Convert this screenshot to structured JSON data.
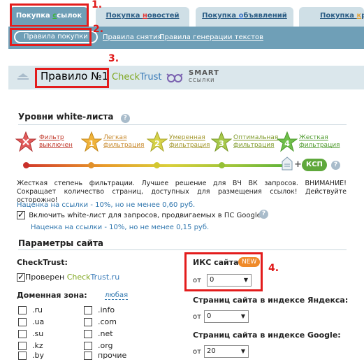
{
  "tabs": [
    {
      "pre": "Покупка ",
      "mark": "с",
      "post": "сылок",
      "active": true
    },
    {
      "pre": "Покупка ",
      "mark": "н",
      "post": "овостей",
      "active": false
    },
    {
      "pre": "Покупка ",
      "mark": "о",
      "post": "бъявлений",
      "active": false
    },
    {
      "pre": "Покупка ",
      "mark": "к",
      "post": "ра",
      "active": false
    }
  ],
  "subnav": {
    "active_label": "Правила покупки",
    "links": [
      "Правила снятия",
      "Правила генерации текстов"
    ]
  },
  "markers": {
    "m1": "1.",
    "m2": "2.",
    "m3": "3.",
    "m4": "4."
  },
  "rule": {
    "title": "Правило №1",
    "checktrust_check": "Check",
    "checktrust_trust": "Trust",
    "smart_top": "SMART",
    "smart_bottom": "ССЫЛКИ"
  },
  "whitelist": {
    "title": "Уровни white-листа",
    "help": "?",
    "levels": [
      {
        "num": "",
        "line1": "Фильтр",
        "line2": "выключен",
        "color": "#e25a5a"
      },
      {
        "num": "1",
        "line1": "Легкая",
        "line2": "фильтрация",
        "color": "#f0b33a"
      },
      {
        "num": "2",
        "line1": "Умеренная",
        "line2": "фильтрация",
        "color": "#d6d24a"
      },
      {
        "num": "3",
        "line1": "Оптимальная",
        "line2": "фильтрация",
        "color": "#a7c94a"
      },
      {
        "num": "4",
        "line1": "Жесткая",
        "line2": "фильтрация",
        "color": "#6fbf4a"
      }
    ],
    "plus": "+",
    "ksp_label": "КСП",
    "description": "Жесткая степень фильтрации. Лучшее решение для ВЧ ВК запросов. ВНИМАНИЕ! Сокращает количество страниц, доступных для размещения ссылок! Действуйте осторожно!",
    "markup1": "Наценка на ссылки - 10%, но не менее 0,60 руб.",
    "google_check_label": "Включить white-лист для запросов, продвигаемых в ПС Google",
    "markup2": "Наценка на ссылки - 10%, но не менее 0,15 руб."
  },
  "site_params": {
    "title": "Параметры сайта",
    "checktrust_heading": "CheckTrust:",
    "checked_label": "Проверен ",
    "checked_brand_check": "Check",
    "checked_brand_rest": "Trust.ru",
    "zone_heading": "Доменная зона:",
    "zone_any": "любая",
    "zones_left": [
      ".ru",
      ".ua",
      ".su",
      ".kz",
      ".by"
    ],
    "zones_right": [
      ".info",
      ".com",
      ".net",
      ".org",
      "прочие"
    ],
    "iks_label": "ИКС сайта:",
    "new_badge": "NEW",
    "from_label": "от",
    "iks_value": "0",
    "yandex_label": "Страниц сайта в индексе Яндекса:",
    "yandex_value": "0",
    "google_label": "Страниц сайта в индексе Google:",
    "google_value": "20"
  }
}
